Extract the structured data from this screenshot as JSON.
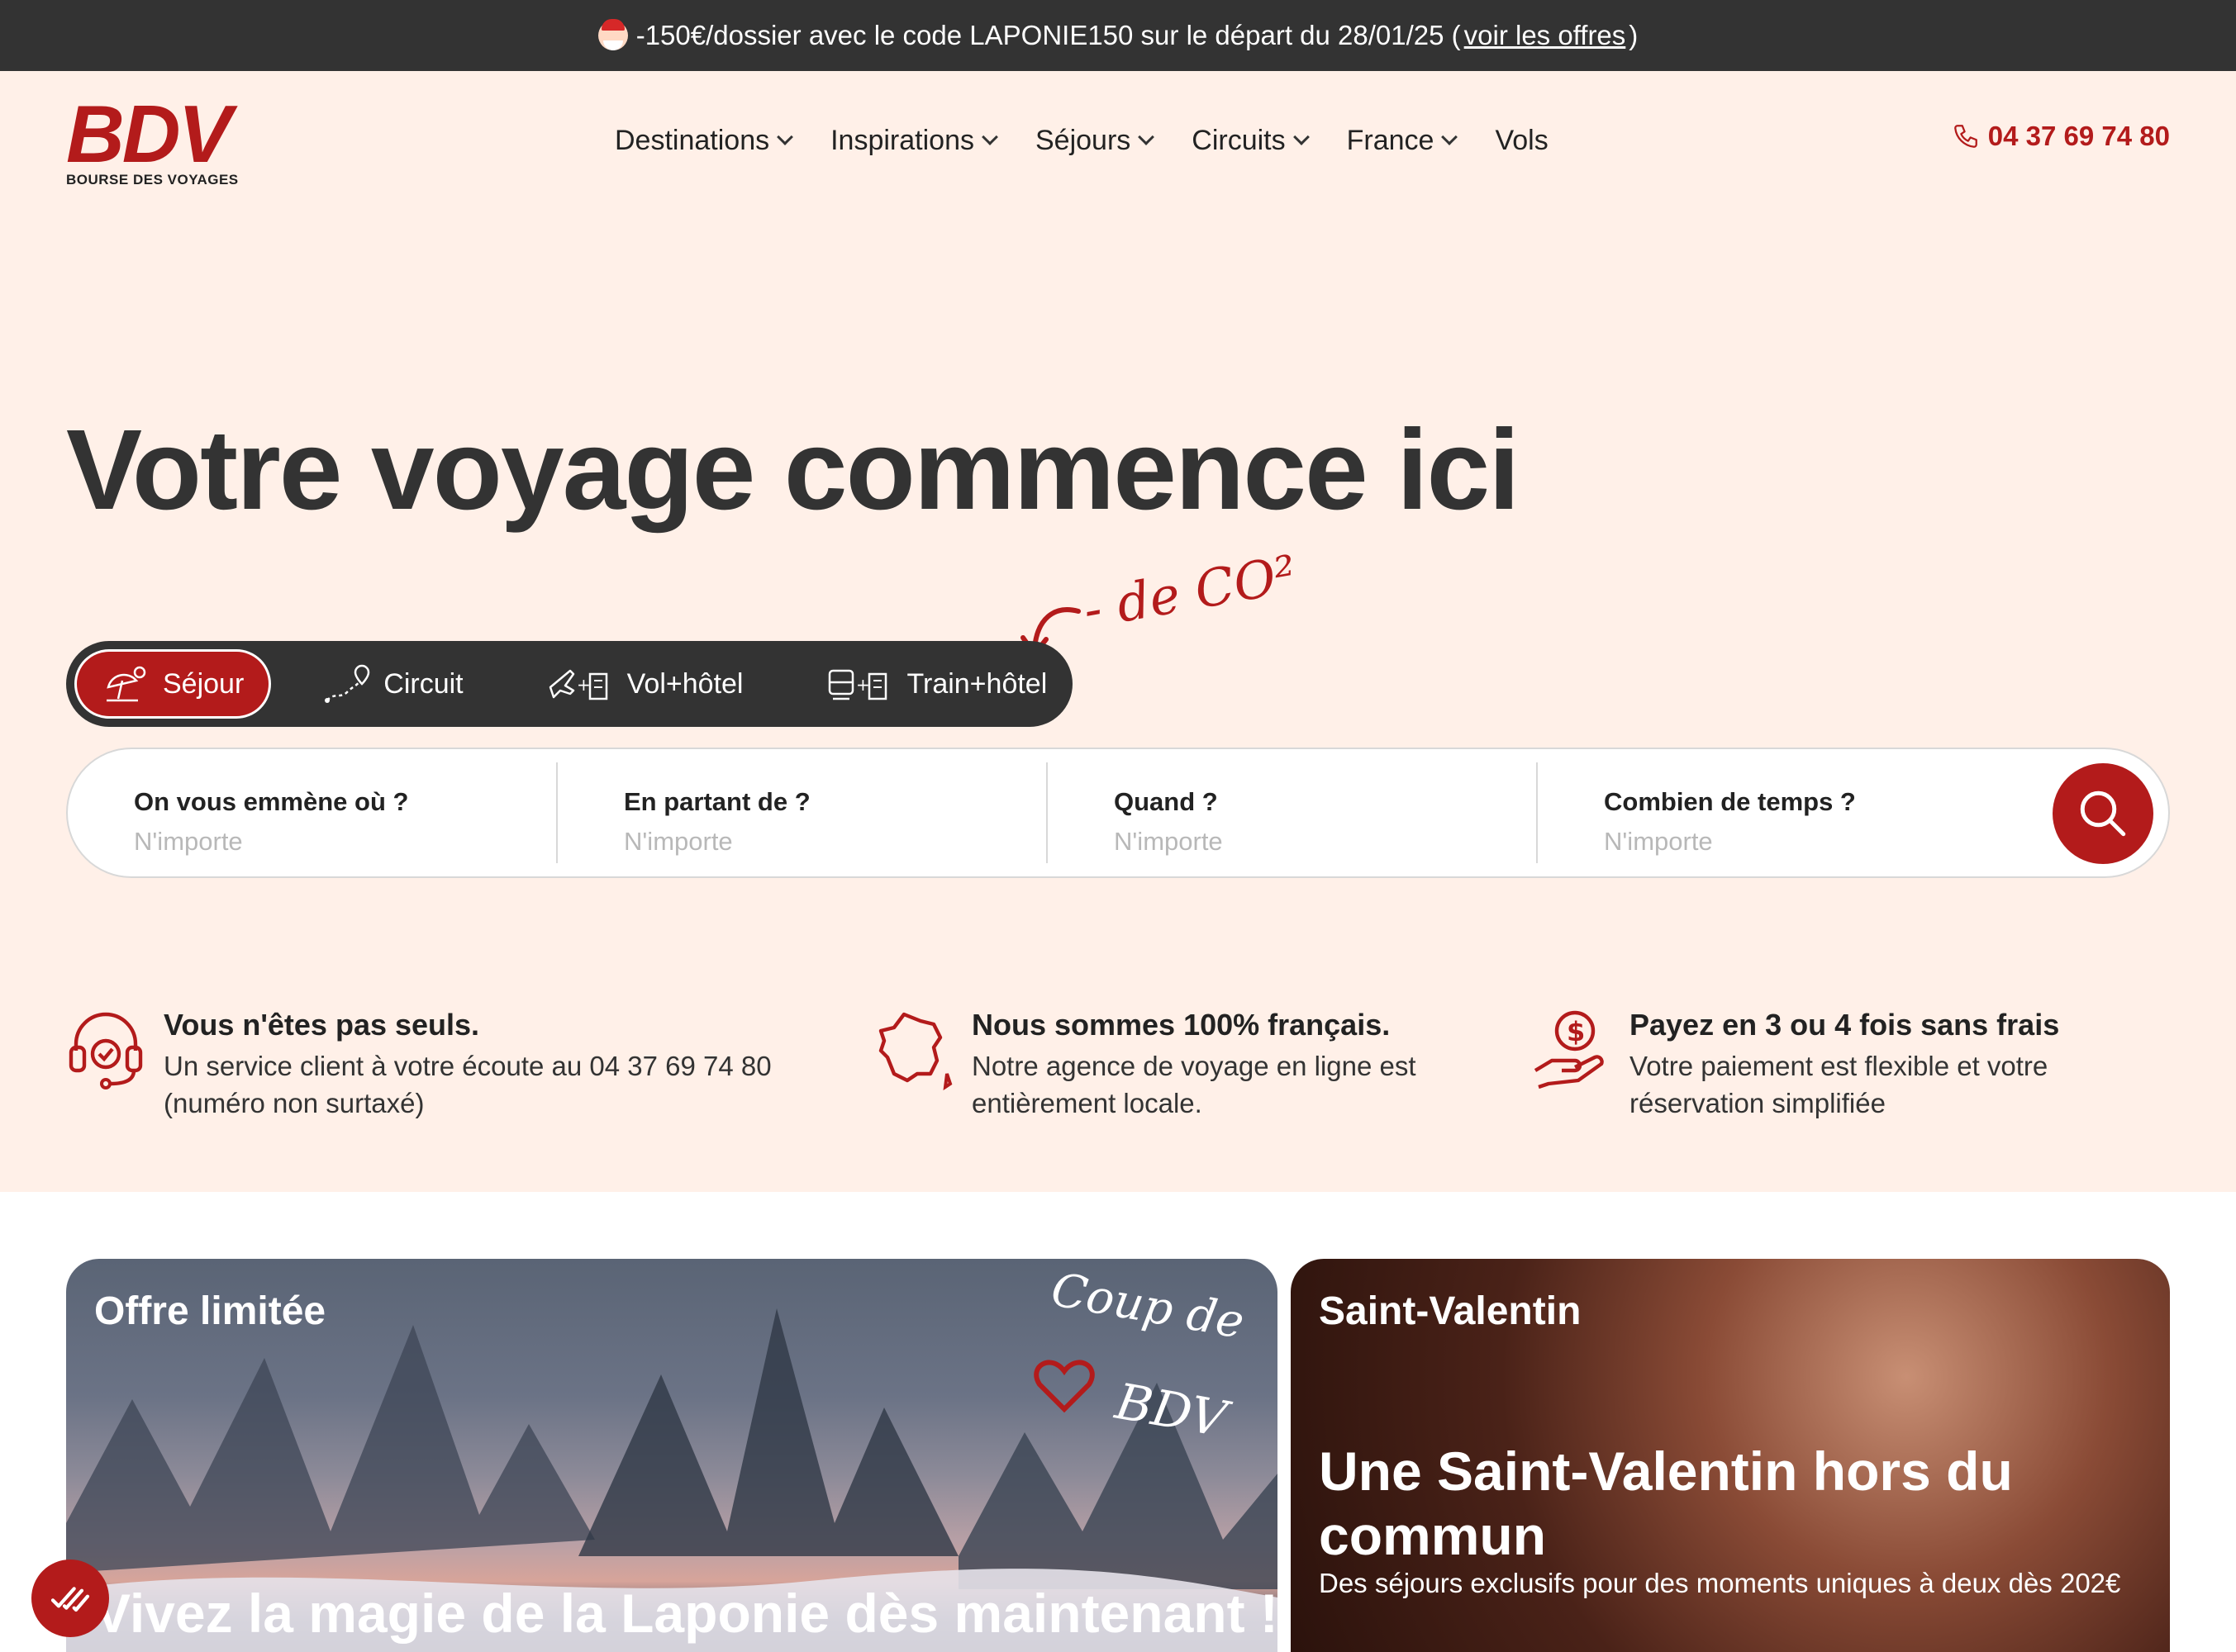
{
  "promo": {
    "text": "-150€/dossier avec le code LAPONIE150 sur le départ du 28/01/25 (",
    "link": "voir les offres",
    "tail": ")"
  },
  "logo": {
    "mark": "BDV",
    "subtitle": "BOURSE DES VOYAGES"
  },
  "nav": {
    "items": [
      {
        "label": "Destinations"
      },
      {
        "label": "Inspirations"
      },
      {
        "label": "Séjours"
      },
      {
        "label": "Circuits"
      },
      {
        "label": "France"
      },
      {
        "label": "Vols"
      }
    ],
    "phone": "04 37 69 74 80"
  },
  "hero": {
    "title": "Votre voyage commence ici",
    "co2_note": "- de CO²"
  },
  "tabs": [
    {
      "label": "Séjour",
      "icon": "beach-umbrella-icon",
      "active": true
    },
    {
      "label": "Circuit",
      "icon": "route-pin-icon"
    },
    {
      "label": "Vol+hôtel",
      "icon": "plane-hotel-icon"
    },
    {
      "label": "Train+hôtel",
      "icon": "train-hotel-icon"
    }
  ],
  "search": {
    "fields": [
      {
        "label": "On vous emmène où ?",
        "placeholder": "N'importe"
      },
      {
        "label": "En partant de ?",
        "placeholder": "N'importe"
      },
      {
        "label": "Quand ?",
        "placeholder": "N'importe"
      },
      {
        "label": "Combien de temps ?",
        "placeholder": "N'importe"
      }
    ]
  },
  "features": [
    {
      "title": "Vous n'êtes pas seuls.",
      "line1": "Un service client à votre écoute au 04 37 69 74 80",
      "line2": "(numéro non surtaxé)",
      "icon": "headset-icon"
    },
    {
      "title": "Nous sommes 100% français.",
      "line1": "Notre agence de voyage en ligne est",
      "line2": "entièrement locale.",
      "icon": "france-map-icon"
    },
    {
      "title": "Payez en 3 ou 4 fois sans frais",
      "line1": "Votre paiement est flexible et votre",
      "line2": "réservation simplifiée",
      "icon": "hand-coin-icon"
    }
  ],
  "cards": [
    {
      "tag": "Offre limitée",
      "title": "Vivez la magie de la Laponie dès maintenant !",
      "sticker": "Coup de BDV"
    },
    {
      "tag": "Saint-Valentin",
      "title": "Une Saint-Valentin hors du commun",
      "desc": "Des séjours exclusifs pour des moments uniques à deux dès 202€"
    }
  ],
  "colors": {
    "brand": "#b31b1b",
    "dark": "#333333",
    "hero_bg": "#fff0e8"
  }
}
